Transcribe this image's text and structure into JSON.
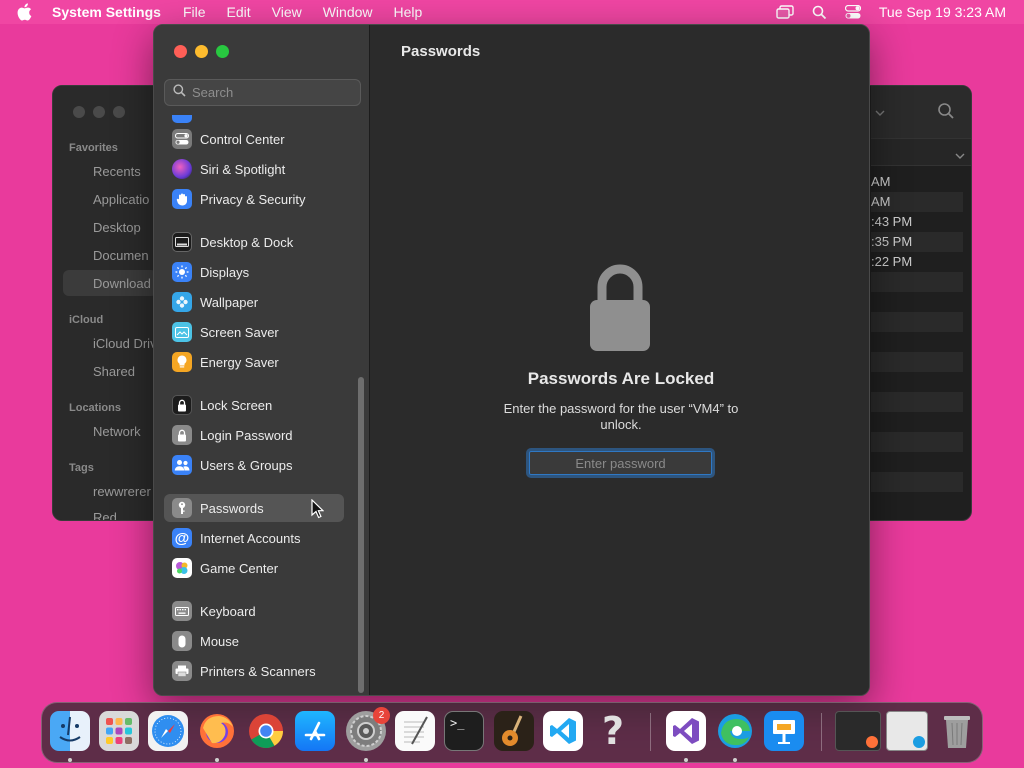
{
  "menubar": {
    "app_name": "System Settings",
    "menus": [
      "File",
      "Edit",
      "View",
      "Window",
      "Help"
    ],
    "clock": "Tue Sep 19  3:23 AM"
  },
  "finder": {
    "sidebar": {
      "favorites_header": "Favorites",
      "favorites": [
        "Recents",
        "Applicatio",
        "Desktop",
        "Documen",
        "Download"
      ],
      "icloud_header": "iCloud",
      "icloud": [
        "iCloud Driv",
        "Shared"
      ],
      "locations_header": "Locations",
      "locations": [
        "Network"
      ],
      "tags_header": "Tags",
      "tags": [
        "rewwrerer",
        "Red"
      ]
    },
    "rows": [
      "AM",
      " AM",
      ":43 PM",
      ":35 PM",
      ":22 PM"
    ]
  },
  "settings": {
    "search_placeholder": "Search",
    "sidebar_items": [
      {
        "label": "Control Center",
        "icon": "control-center-icon",
        "color": "#7a7a7a"
      },
      {
        "label": "Siri & Spotlight",
        "icon": "siri-icon",
        "color": "#8a3fd0"
      },
      {
        "label": "Privacy & Security",
        "icon": "hand-icon",
        "color": "#3a82f7"
      },
      {
        "label": "Desktop & Dock",
        "icon": "dock-icon",
        "color": "#1c1c1c"
      },
      {
        "label": "Displays",
        "icon": "sun-icon",
        "color": "#3a82f7"
      },
      {
        "label": "Wallpaper",
        "icon": "flower-icon",
        "color": "#35a6e8"
      },
      {
        "label": "Screen Saver",
        "icon": "screen-saver-icon",
        "color": "#4cc3e6"
      },
      {
        "label": "Energy Saver",
        "icon": "bulb-icon",
        "color": "#f5a623"
      },
      {
        "label": "Lock Screen",
        "icon": "lock-screen-icon",
        "color": "#1c1c1c"
      },
      {
        "label": "Login Password",
        "icon": "login-lock-icon",
        "color": "#8a8a8a"
      },
      {
        "label": "Users & Groups",
        "icon": "users-icon",
        "color": "#3a82f7"
      },
      {
        "label": "Passwords",
        "icon": "key-icon",
        "color": "#8a8a8a"
      },
      {
        "label": "Internet Accounts",
        "icon": "at-icon",
        "color": "#3a82f7"
      },
      {
        "label": "Game Center",
        "icon": "game-center-icon",
        "color": "#ffffff"
      },
      {
        "label": "Keyboard",
        "icon": "keyboard-icon",
        "color": "#8a8a8a"
      },
      {
        "label": "Mouse",
        "icon": "mouse-icon",
        "color": "#8a8a8a"
      },
      {
        "label": "Printers & Scanners",
        "icon": "printer-icon",
        "color": "#8a8a8a"
      }
    ],
    "selected": "Passwords",
    "content": {
      "title": "Passwords",
      "heading": "Passwords Are Locked",
      "description": "Enter the password for the user “VM4” to unlock.",
      "password_placeholder": "Enter password"
    }
  },
  "dock": {
    "apps": [
      "Finder",
      "Launchpad",
      "Safari",
      "Firefox",
      "Chrome",
      "App Store",
      "System Settings",
      "TextEdit",
      "Terminal",
      "GarageBand",
      "Visual Studio Code",
      "Help",
      "Visual Studio",
      "Edge",
      "Keynote"
    ],
    "settings_badge": "2"
  }
}
